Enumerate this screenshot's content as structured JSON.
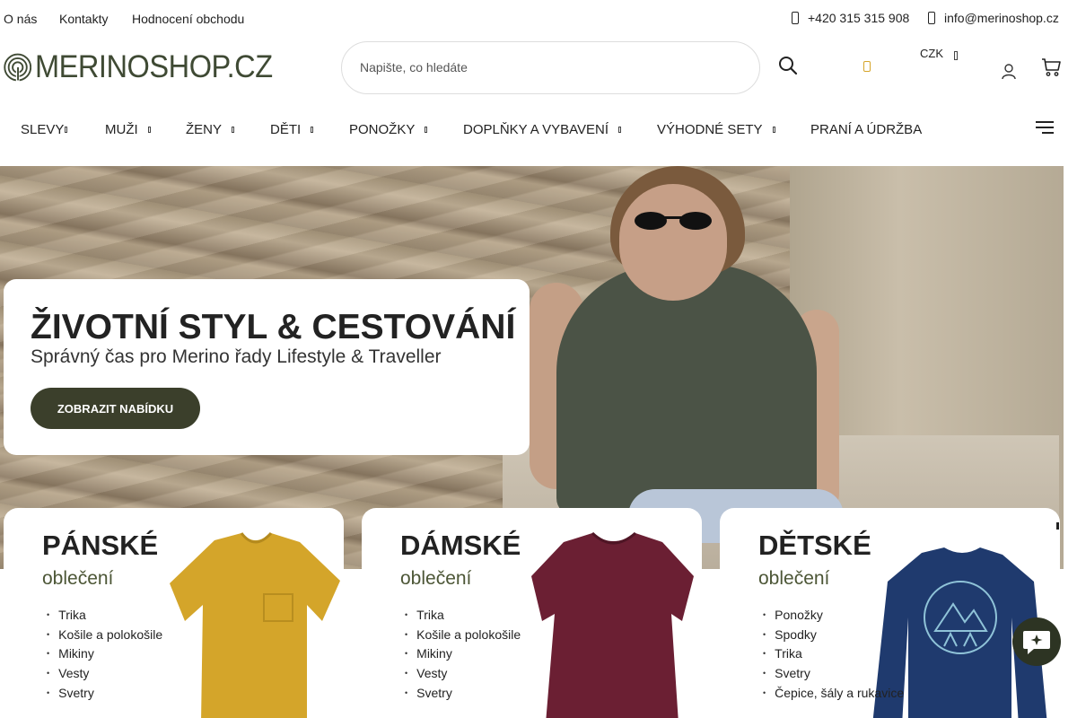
{
  "topbar": {
    "links": [
      "O nás",
      "Kontakty",
      "Hodnocení obchodu"
    ],
    "phone": "+420 315 315 908",
    "email": "info@merinoshop.cz"
  },
  "header": {
    "logo_text": "MERINOSHOP.CZ",
    "search_placeholder": "Napište, co hledáte",
    "currency": "CZK",
    "icons": [
      "search-icon",
      "flag-icon",
      "user-icon",
      "cart-icon"
    ]
  },
  "nav": {
    "items": [
      "SLEVY",
      "MUŽI",
      "ŽENY",
      "DĚTI",
      "PONOŽKY",
      "DOPLŇKY A VYBAVENÍ",
      "VÝHODNÉ SETY",
      "PRANÍ A ÚDRŽBA"
    ]
  },
  "hero": {
    "title": "ŽIVOTNÍ STYL & CESTOVÁNÍ",
    "subtitle": "Správný čas pro Merino řady Lifestyle & Traveller",
    "button": "ZOBRAZIT NABÍDKU"
  },
  "categories": [
    {
      "title": "PÁNSKÉ",
      "subtitle": "oblečení",
      "items": [
        "Trika",
        "Košile a polokošile",
        "Mikiny",
        "Vesty",
        "Svetry"
      ],
      "image_color": "#d4a52a"
    },
    {
      "title": "DÁMSKÉ",
      "subtitle": "oblečení",
      "items": [
        "Trika",
        "Košile a polokošile",
        "Mikiny",
        "Vesty",
        "Svetry"
      ],
      "image_color": "#6b1f33"
    },
    {
      "title": "DĚTSKÉ",
      "subtitle": "oblečení",
      "items": [
        "Ponožky",
        "Spodky",
        "Trika",
        "Svetry",
        "Čepice, šály a rukavice"
      ],
      "image_color": "#1f3a6e"
    }
  ],
  "colors": {
    "brand": "#3f4a34",
    "button": "#3b3f2b",
    "accent_flag": "#d6a52a"
  }
}
